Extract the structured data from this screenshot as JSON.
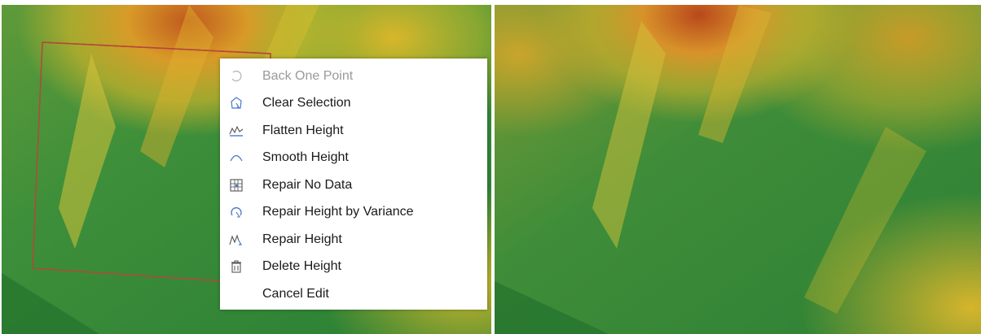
{
  "context_menu": {
    "items": [
      {
        "label": "Back One Point",
        "icon": "undo-arc-icon",
        "enabled": false
      },
      {
        "label": "Clear Selection",
        "icon": "clear-selection-icon",
        "enabled": true
      },
      {
        "label": "Flatten Height",
        "icon": "flatten-height-icon",
        "enabled": true
      },
      {
        "label": "Smooth Height",
        "icon": "smooth-height-icon",
        "enabled": true
      },
      {
        "label": "Repair No Data",
        "icon": "repair-no-data-icon",
        "enabled": true
      },
      {
        "label": "Repair Height by Variance",
        "icon": "repair-variance-icon",
        "enabled": true
      },
      {
        "label": "Repair Height",
        "icon": "repair-height-icon",
        "enabled": true
      },
      {
        "label": "Delete Height",
        "icon": "trash-icon",
        "enabled": true
      },
      {
        "label": "Cancel Edit",
        "icon": "",
        "enabled": true
      }
    ]
  },
  "colors": {
    "selection_outline": "#b5473a",
    "terrain_low": "#2e8a3c",
    "terrain_mid": "#c9b22a",
    "terrain_high": "#b3521d",
    "icon_blue": "#4a78c8",
    "disabled_text": "#9a9a9a"
  }
}
